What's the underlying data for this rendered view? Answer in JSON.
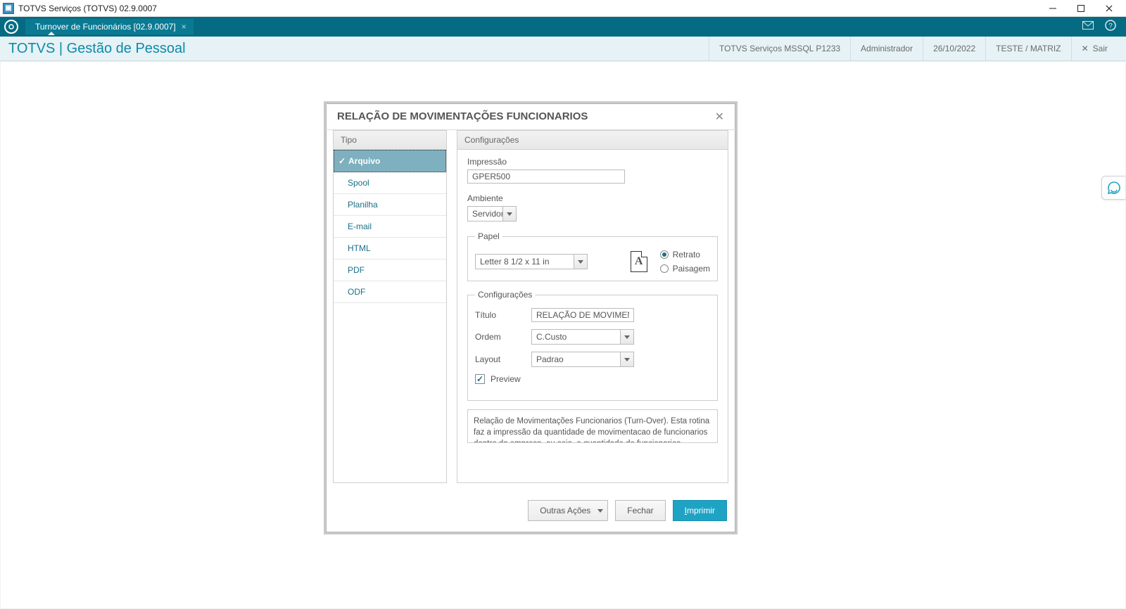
{
  "window": {
    "title": "TOTVS Serviços (TOTVS) 02.9.0007"
  },
  "ribbon": {
    "tab_label": "Turnover de Funcionários [02.9.0007]"
  },
  "header": {
    "app_title": "TOTVS | Gestão de Pessoal",
    "service": "TOTVS Serviços MSSQL P1233",
    "user": "Administrador",
    "date": "26/10/2022",
    "env": "TESTE / MATRIZ",
    "exit": "Sair"
  },
  "dialog": {
    "title": "RELAÇÃO DE MOVIMENTAÇÕES FUNCIONARIOS",
    "left_title": "Tipo",
    "tipo_items": [
      "Arquivo",
      "Spool",
      "Planilha",
      "E-mail",
      "HTML",
      "PDF",
      "ODF"
    ],
    "right_title": "Configurações",
    "labels": {
      "impressao": "Impressão",
      "ambiente": "Ambiente",
      "papel": "Papel",
      "retrato": "Retrato",
      "paisagem": "Paisagem",
      "config_group": "Configurações",
      "titulo": "Título",
      "ordem": "Ordem",
      "layout": "Layout",
      "preview": "Preview"
    },
    "values": {
      "impressao": "GPER500",
      "ambiente": "Servidor",
      "papel": "Letter 8 1/2 x 11 in",
      "titulo": "RELAÇÃO DE MOVIMENTAÇÕE",
      "ordem": "C.Custo",
      "layout": "Padrao"
    },
    "description": "Relação de Movimentações Funcionarios (Turn-Over). Esta rotina faz a impressão da quantidade de movimentacao de funcionarios dentro da empresa, ou seja,  a quantidade de funcionarios demitidos, admitidos e",
    "buttons": {
      "outras": "Outras Ações",
      "fechar": "Fechar",
      "imprimir_first": "I",
      "imprimir_rest": "mprimir"
    }
  }
}
